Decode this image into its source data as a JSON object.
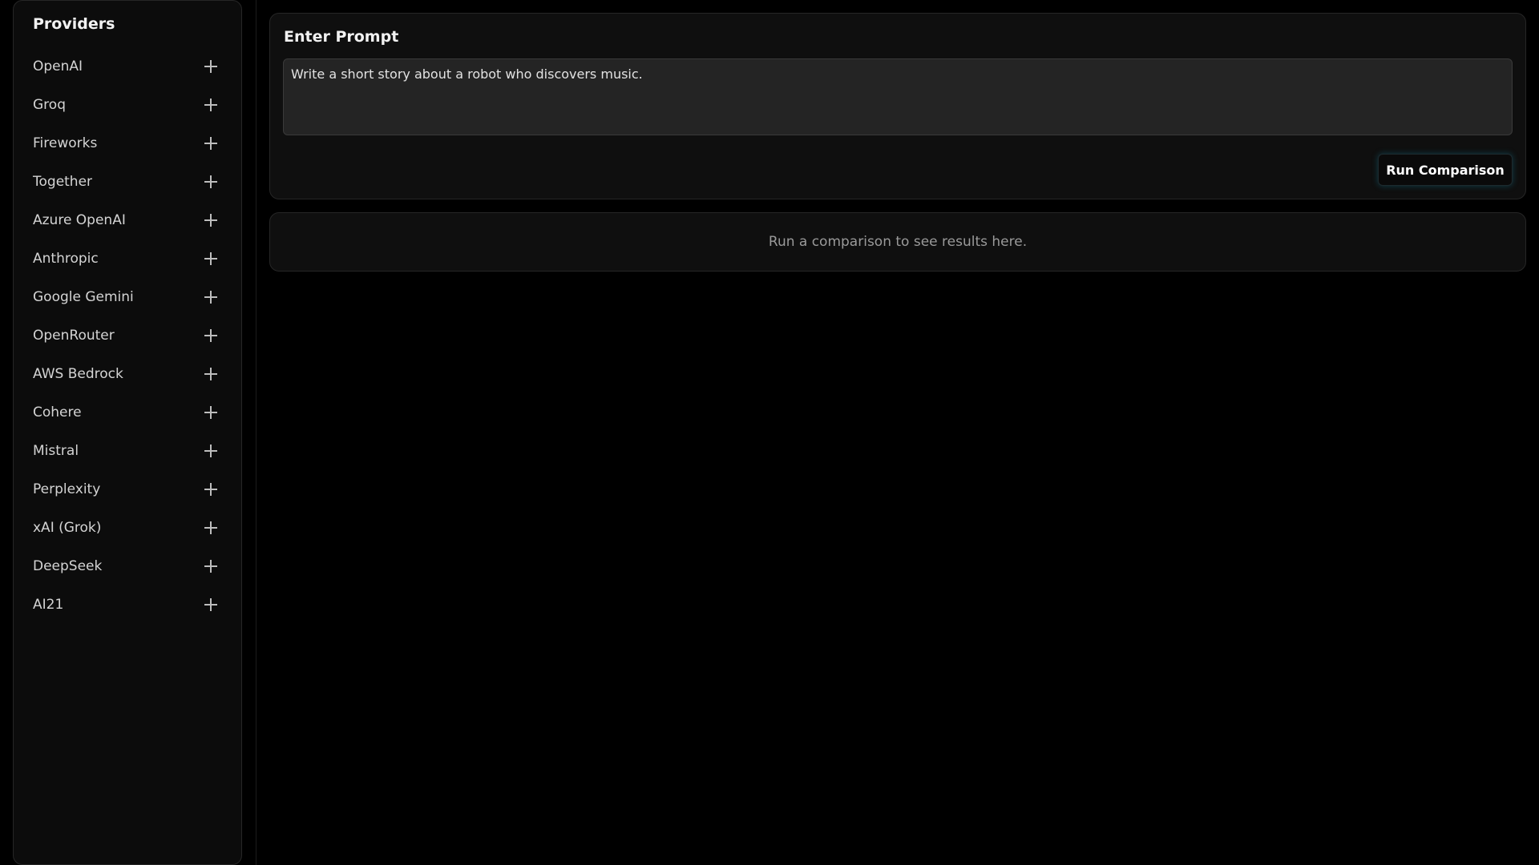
{
  "sidebar": {
    "title": "Providers",
    "items": [
      {
        "label": "OpenAI",
        "name": "openai"
      },
      {
        "label": "Groq",
        "name": "groq"
      },
      {
        "label": "Fireworks",
        "name": "fireworks"
      },
      {
        "label": "Together",
        "name": "together"
      },
      {
        "label": "Azure OpenAI",
        "name": "azure-openai"
      },
      {
        "label": "Anthropic",
        "name": "anthropic"
      },
      {
        "label": "Google Gemini",
        "name": "google-gemini"
      },
      {
        "label": "OpenRouter",
        "name": "openrouter"
      },
      {
        "label": "AWS Bedrock",
        "name": "aws-bedrock"
      },
      {
        "label": "Cohere",
        "name": "cohere"
      },
      {
        "label": "Mistral",
        "name": "mistral"
      },
      {
        "label": "Perplexity",
        "name": "perplexity"
      },
      {
        "label": "xAI (Grok)",
        "name": "xai-grok"
      },
      {
        "label": "DeepSeek",
        "name": "deepseek"
      },
      {
        "label": "AI21",
        "name": "ai21"
      }
    ],
    "item_icon": "plus-icon"
  },
  "prompt": {
    "title": "Enter Prompt",
    "value": "Write a short story about a robot who discovers music.",
    "run_label": "Run Comparison"
  },
  "results": {
    "placeholder": "Run a comparison to see results here."
  },
  "colors": {
    "background": "#000000",
    "card": "#0f0f0f",
    "input": "#242424",
    "accent_glow": "#1496b4"
  }
}
